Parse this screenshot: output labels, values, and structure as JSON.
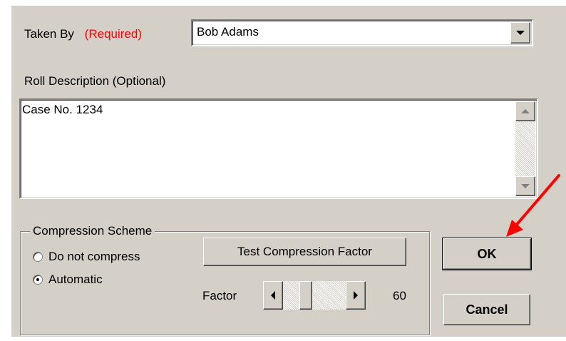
{
  "taken_by": {
    "label": "Taken By",
    "required_tag": "(Required)",
    "value": "Bob Adams"
  },
  "roll_description": {
    "label": "Roll Description (Optional)",
    "value": "Case No. 1234"
  },
  "compression": {
    "legend": "Compression Scheme",
    "options": [
      {
        "label": "Do not compress",
        "checked": false
      },
      {
        "label": "Automatic",
        "checked": true
      }
    ],
    "test_button": "Test Compression Factor",
    "factor_label": "Factor",
    "factor_value": "60"
  },
  "buttons": {
    "ok": "OK",
    "cancel": "Cancel"
  },
  "colors": {
    "required": "#ff0000",
    "dialog_bg": "#d4d0c8",
    "annotation_arrow": "#ff0000"
  }
}
